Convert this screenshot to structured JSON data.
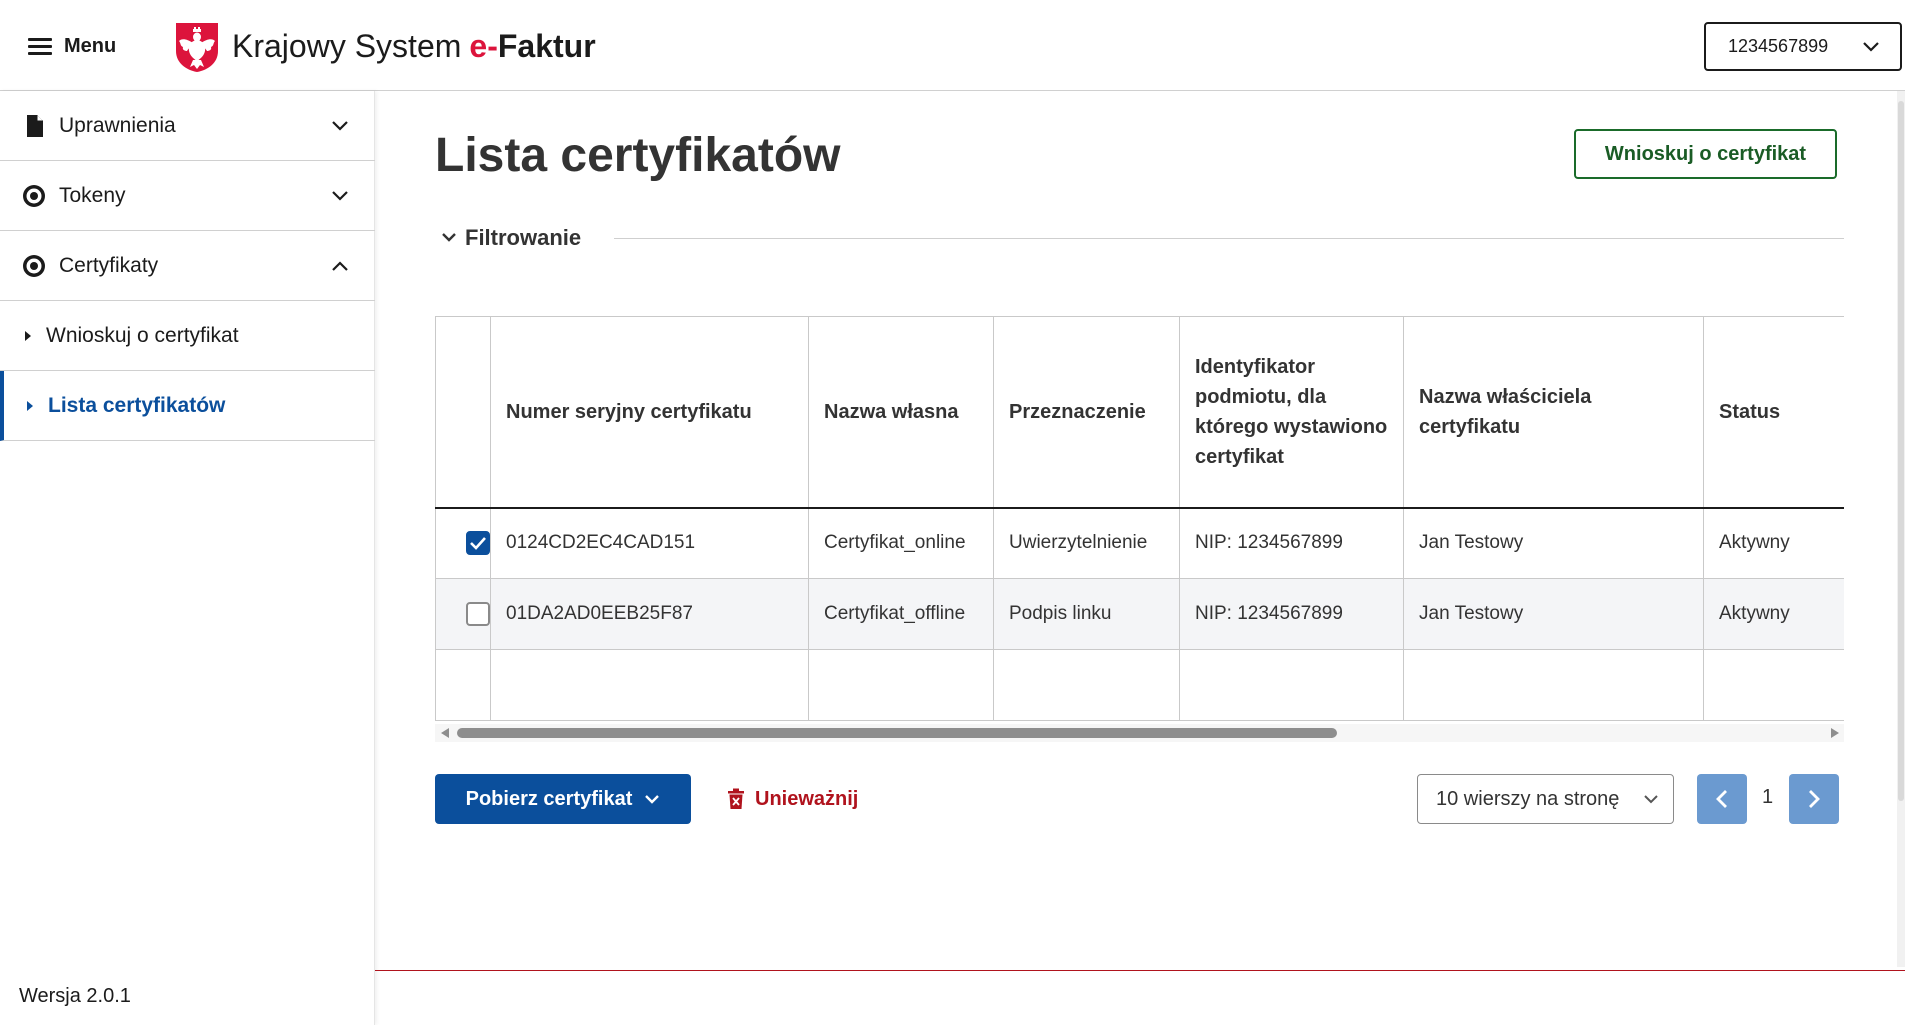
{
  "header": {
    "menu_label": "Menu",
    "brand_part1": "Krajowy System",
    "brand_part2": "e-",
    "brand_part3": "Faktur",
    "nip_selector_value": "1234567899"
  },
  "sidebar": {
    "items": [
      {
        "label": "Uprawnienia",
        "icon": "document-icon",
        "expanded": false
      },
      {
        "label": "Tokeny",
        "icon": "token-icon",
        "expanded": false
      },
      {
        "label": "Certyfikaty",
        "icon": "certificate-icon",
        "expanded": true
      }
    ],
    "subitems": [
      {
        "label": "Wnioskuj o certyfikat",
        "active": false
      },
      {
        "label": "Lista certyfikatów",
        "active": true
      }
    ],
    "version": "Wersja 2.0.1"
  },
  "main": {
    "title": "Lista certyfikatów",
    "request_button": "Wnioskuj o certyfikat",
    "filter_label": "Filtrowanie",
    "table": {
      "headers": [
        "Numer seryjny certyfikatu",
        "Nazwa własna",
        "Przeznaczenie",
        "Identyfikator podmiotu, dla którego wystawiono certyfikat",
        "Nazwa właściciela certyfikatu",
        "Status"
      ],
      "rows": [
        {
          "checked": true,
          "serial": "0124CD2EC4CAD151",
          "name": "Certyfikat_online",
          "purpose": "Uwierzytelnienie",
          "identifier": "NIP: 1234567899",
          "owner": "Jan Testowy",
          "status": "Aktywny"
        },
        {
          "checked": false,
          "serial": "01DA2AD0EEB25F87",
          "name": "Certyfikat_offline",
          "purpose": "Podpis linku",
          "identifier": "NIP: 1234567899",
          "owner": "Jan Testowy",
          "status": "Aktywny"
        }
      ]
    },
    "download_button": "Pobierz certyfikat",
    "revoke_button": "Unieważnij",
    "rows_per_page": "10 wierszy na stronę",
    "current_page": "1"
  },
  "colors": {
    "primary_blue": "#0b4f9c",
    "green_outline": "#1a6b2a",
    "accent_red": "#dc143c",
    "revoke_red": "#b0131d",
    "pager_blue": "#6b9ad0"
  }
}
